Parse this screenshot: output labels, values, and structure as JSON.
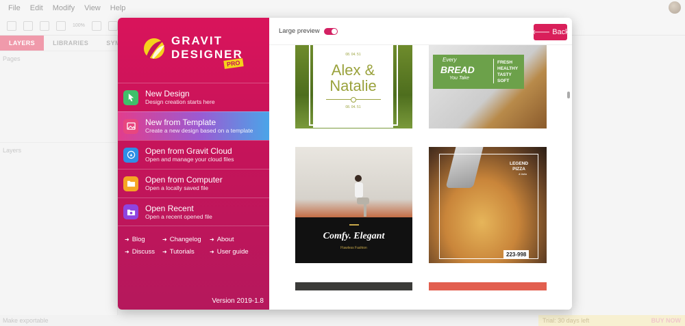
{
  "menubar": {
    "items": [
      "File",
      "Edit",
      "Modify",
      "View",
      "Help"
    ]
  },
  "toolbar": {
    "zoom": "100%"
  },
  "left_panel": {
    "tabs": [
      "LAYERS",
      "LIBRARIES",
      "SYMBOLS"
    ],
    "pages_label": "Pages",
    "layers_label": "Layers",
    "export_label": "Make exportable"
  },
  "trial": {
    "text": "Trial: 30 days left",
    "buy": "BUY NOW"
  },
  "dialog": {
    "logo": {
      "line1": "GRAVIT",
      "line2": "DESIGNER",
      "badge": "PRO"
    },
    "menu": [
      {
        "title": "New Design",
        "subtitle": "Design creation starts here",
        "icon": "cursor-icon",
        "color": "#3fbf6a"
      },
      {
        "title": "New from Template",
        "subtitle": "Create a new design based on a template",
        "icon": "image-icon",
        "color": "#e8467f"
      },
      {
        "title": "Open from Gravit Cloud",
        "subtitle": "Open and manage your cloud files",
        "icon": "cloud-icon",
        "color": "#2e8fe6"
      },
      {
        "title": "Open from Computer",
        "subtitle": "Open a locally saved file",
        "icon": "folder-icon",
        "color": "#f5a623"
      },
      {
        "title": "Open Recent",
        "subtitle": "Open a recent opened file",
        "icon": "recent-folder-icon",
        "color": "#8e44e0"
      }
    ],
    "links": [
      "Blog",
      "Changelog",
      "About",
      "Discuss",
      "Tutorials",
      "User guide"
    ],
    "version": "Version 2019-1.8",
    "large_preview_label": "Large preview",
    "large_preview_on": true,
    "back_label": "Back",
    "templates": {
      "wedding": {
        "date_top": "08. 04. 51",
        "names": "Alex & Natalie",
        "date_bottom": "08. 04. 51"
      },
      "bread": {
        "every": "Every",
        "bread": "BREAD",
        "you_take": "You Take",
        "list": [
          "FRESH",
          "HEALTHY",
          "TASTY",
          "SOFT"
        ]
      },
      "comfy": {
        "title": "Comfy. Elegant",
        "subtitle": "Flawless Fashion"
      },
      "pizza": {
        "legend": "LEGEND",
        "pizza": "PIZZA",
        "tagline": "& italia",
        "price": "223-998"
      }
    }
  },
  "colors": {
    "accent": "#d91f5a",
    "sidebar_top": "#d9145b",
    "sidebar_bottom": "#b5185c"
  }
}
